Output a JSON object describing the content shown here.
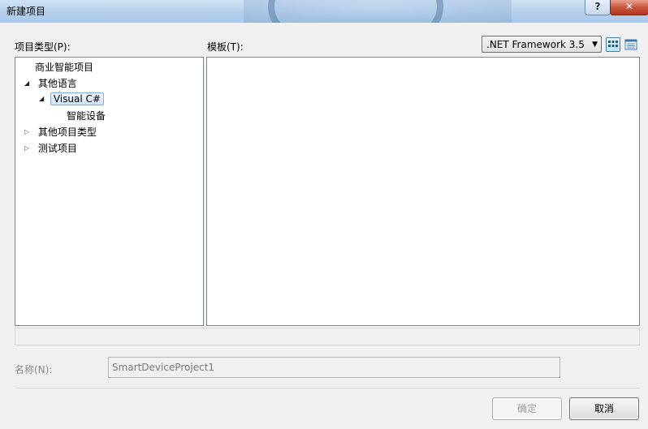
{
  "window": {
    "title": "新建项目",
    "help_label": "?",
    "close_label": "✕"
  },
  "project_types": {
    "label": "项目类型(P):",
    "items": [
      {
        "label": "商业智能项目",
        "expander": ""
      },
      {
        "label": "其他语言",
        "expander": "◢"
      },
      {
        "label": "Visual C#",
        "expander": "◢",
        "selected": true
      },
      {
        "label": "智能设备",
        "expander": ""
      },
      {
        "label": "其他项目类型",
        "expander": "▷"
      },
      {
        "label": "测试项目",
        "expander": "▷"
      }
    ]
  },
  "templates": {
    "label": "模板(T):",
    "items": []
  },
  "framework": {
    "selected": ".NET Framework 3.5",
    "caret": "▼"
  },
  "view_icons": [
    "large-icons-view-icon",
    "small-icons-view-icon"
  ],
  "description": "",
  "name_field": {
    "label": "名称(N):",
    "value": "SmartDeviceProject1"
  },
  "buttons": {
    "ok": "确定",
    "cancel": "取消"
  },
  "colors": {
    "selection_border": "#84acdd",
    "close_red": "#c8563c",
    "title_blue": "#b9d3ee"
  }
}
